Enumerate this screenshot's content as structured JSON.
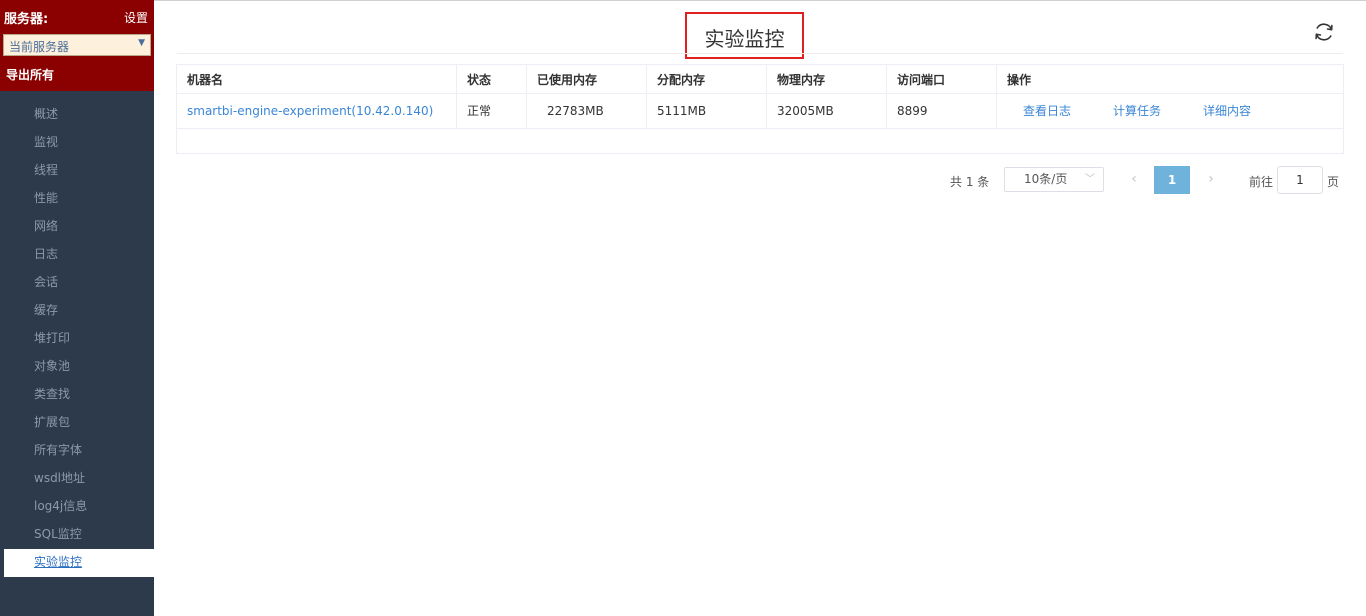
{
  "sidebar": {
    "server_label": "服务器:",
    "settings_label": "设置",
    "server_select_value": "当前服务器",
    "export_all_label": "导出所有",
    "items": [
      {
        "label": "概述"
      },
      {
        "label": "监视"
      },
      {
        "label": "线程"
      },
      {
        "label": "性能"
      },
      {
        "label": "网络"
      },
      {
        "label": "日志"
      },
      {
        "label": "会话"
      },
      {
        "label": "缓存"
      },
      {
        "label": "堆打印"
      },
      {
        "label": "对象池"
      },
      {
        "label": "类查找"
      },
      {
        "label": "扩展包"
      },
      {
        "label": "所有字体"
      },
      {
        "label": "wsdl地址"
      },
      {
        "label": "log4j信息"
      },
      {
        "label": "SQL监控"
      },
      {
        "label": "实验监控"
      }
    ],
    "active_item": "实验监控"
  },
  "main": {
    "title": "实验监控",
    "refresh_icon": "refresh-icon",
    "table": {
      "columns": [
        "机器名",
        "状态",
        "已使用内存",
        "分配内存",
        "物理内存",
        "访问端口",
        "操作"
      ],
      "rows": [
        {
          "machine": "smartbi-engine-experiment(10.42.0.140)",
          "status": "正常",
          "used_memory": "22783MB",
          "allocated_memory": "5111MB",
          "physical_memory": "32005MB",
          "port": "8899",
          "actions": [
            "查看日志",
            "计算任务",
            "详细内容"
          ]
        }
      ]
    },
    "pagination": {
      "total": "共 1 条",
      "page_size": "10条/页",
      "current_page": "1",
      "goto_label": "前往",
      "goto_value": "1",
      "page_unit": "页"
    }
  },
  "colors": {
    "sidebar_bg": "#2c3a4b",
    "sidebar_header_bg": "#8b0000",
    "link_blue": "#3a86d6",
    "active_page_bg": "#6fb3dd",
    "title_highlight_border": "#e02020"
  }
}
